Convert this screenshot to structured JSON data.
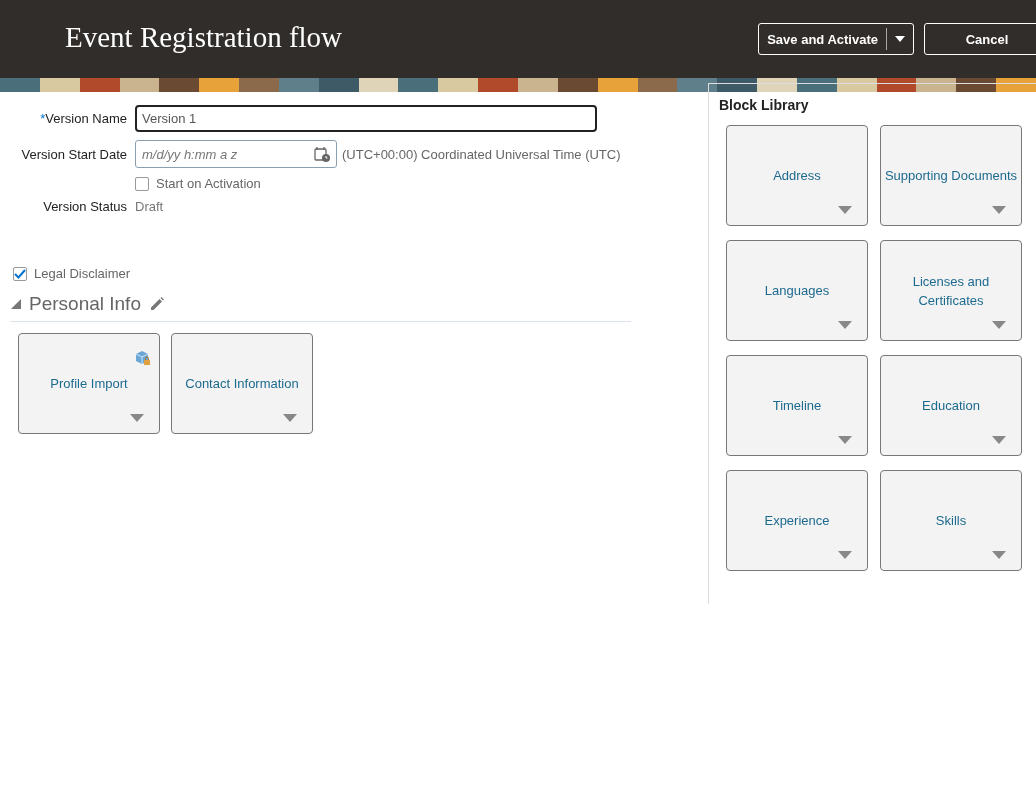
{
  "header": {
    "title": "Event Registration flow",
    "buttons": [
      {
        "label": "Save and Activate",
        "kind": "split"
      },
      {
        "label": "Cancel",
        "kind": "plain"
      }
    ]
  },
  "form": {
    "version_name": {
      "label": "Version Name",
      "required": true,
      "required_mark": "*",
      "value": "Version 1"
    },
    "start_date": {
      "label": "Version Start Date",
      "placeholder": "m/d/yy h:mm a z",
      "timezone": "(UTC+00:00) Coordinated Universal Time (UTC)"
    },
    "start_on_activation": {
      "label": "Start on Activation",
      "checked": false
    },
    "status": {
      "label": "Version Status",
      "value": "Draft"
    }
  },
  "legal_disclaimer": {
    "label": "Legal Disclaimer",
    "checked": true
  },
  "section": {
    "title": "Personal Info",
    "expanded": true,
    "blocks": [
      {
        "label": "Profile Import",
        "locked": true
      },
      {
        "label": "Contact Information",
        "locked": false
      }
    ]
  },
  "block_library": {
    "title": "Block Library",
    "blocks": [
      {
        "label": "Address"
      },
      {
        "label": "Supporting Documents"
      },
      {
        "label": "Languages"
      },
      {
        "label": "Licenses and Certificates"
      },
      {
        "label": "Timeline"
      },
      {
        "label": "Education"
      },
      {
        "label": "Experience"
      },
      {
        "label": "Skills"
      }
    ]
  }
}
